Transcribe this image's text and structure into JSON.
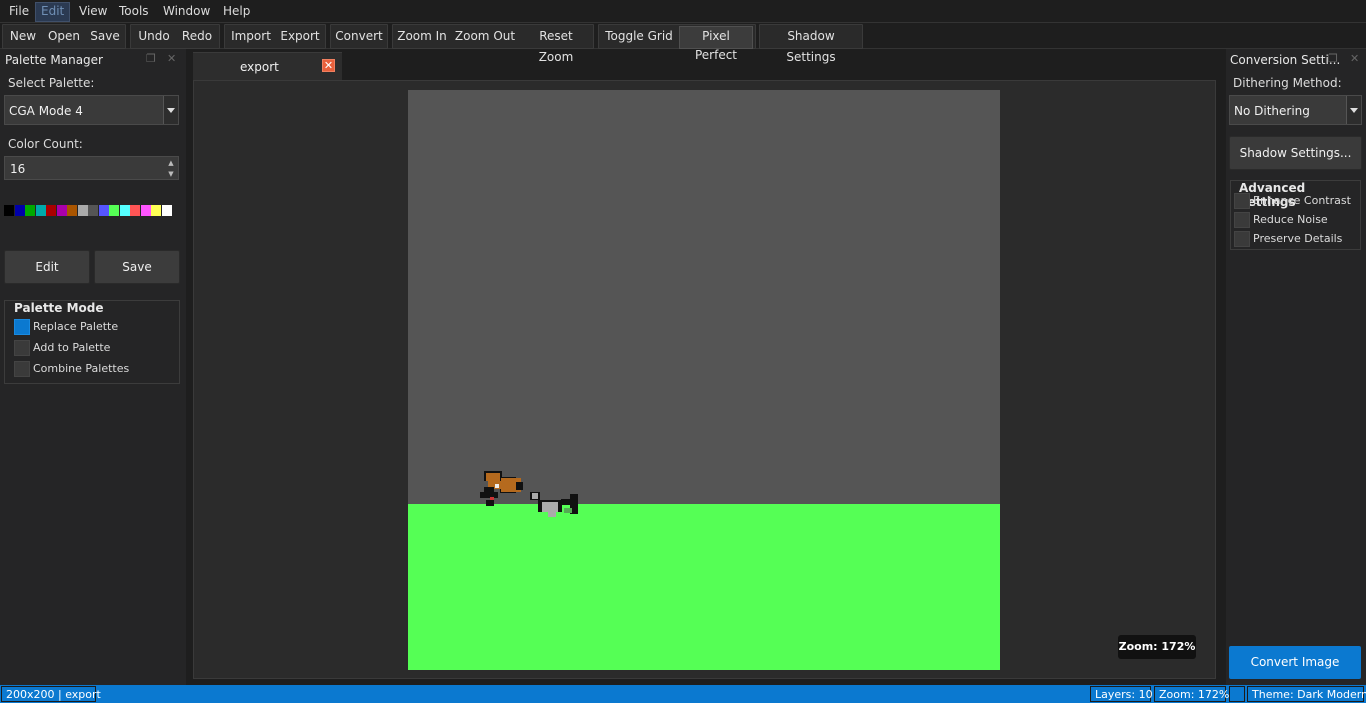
{
  "menu": [
    "File",
    "Edit",
    "View",
    "Tools",
    "Window",
    "Help"
  ],
  "toolbar": {
    "new": "New",
    "open": "Open",
    "save": "Save",
    "undo": "Undo",
    "redo": "Redo",
    "import": "Import",
    "export": "Export",
    "convert": "Convert",
    "zoom_in": "Zoom In",
    "zoom_out": "Zoom Out",
    "reset_zoom": "Reset Zoom",
    "toggle_grid": "Toggle Grid",
    "pixel_perfect": "Pixel Perfect",
    "shadow_settings": "Shadow Settings"
  },
  "palette_manager": {
    "title": "Palette Manager",
    "select_label": "Select Palette:",
    "selected_palette": "CGA Mode 4",
    "color_count_label": "Color Count:",
    "color_count": "16",
    "swatches": [
      "#000000",
      "#0000aa",
      "#00aa00",
      "#00aaaa",
      "#aa0000",
      "#aa00aa",
      "#aa5500",
      "#aaaaaa",
      "#555555",
      "#5555ff",
      "#55ff55",
      "#55ffff",
      "#ff5555",
      "#ff55ff",
      "#ffff55",
      "#ffffff"
    ],
    "edit_button": "Edit",
    "save_button": "Save",
    "mode_group": {
      "title": "Palette Mode",
      "options": [
        {
          "label": "Replace Palette",
          "checked": true
        },
        {
          "label": "Add to Palette",
          "checked": false
        },
        {
          "label": "Combine Palettes",
          "checked": false
        }
      ]
    }
  },
  "document": {
    "tab_label": "export",
    "zoom_overlay": "Zoom: 172%",
    "colors": {
      "sky": "#555555",
      "ground": "#55ff55"
    }
  },
  "conversion": {
    "title": "Conversion Setti...",
    "dithering_label": "Dithering Method:",
    "dithering_value": "No Dithering",
    "shadow_button": "Shadow Settings...",
    "advanced": {
      "title": "Advanced Settings",
      "options": [
        {
          "label": "Enhance Contrast",
          "checked": false
        },
        {
          "label": "Reduce Noise",
          "checked": false
        },
        {
          "label": "Preserve Details",
          "checked": false
        }
      ]
    },
    "convert_button": "Convert Image"
  },
  "status": {
    "dimensions": "200x200 | export",
    "layers": "Layers: 10",
    "zoom": "Zoom: 172%",
    "theme": "Theme: Dark Modern"
  },
  "accent_color": "#0b79d0"
}
